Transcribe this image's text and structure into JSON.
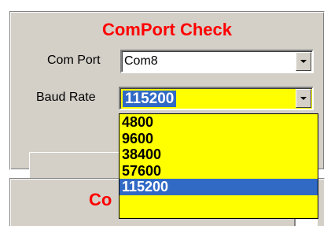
{
  "panel": {
    "title": "ComPort Check",
    "title_color": "#ff0000",
    "com_port_label": "Com Port",
    "com_port_value": "Com8",
    "baud_rate_label": "Baud Rate",
    "baud_rate_value": "115200",
    "baud_field_color": "#ffff00",
    "selection_color": "#316ac5"
  },
  "panel2": {
    "title_fragment": "Co"
  },
  "baud_dropdown": {
    "options": [
      "4800",
      "9600",
      "38400",
      "57600",
      "115200"
    ],
    "selected": "115200"
  },
  "icons": {
    "dropdown_arrow": "chevron-down-icon"
  }
}
